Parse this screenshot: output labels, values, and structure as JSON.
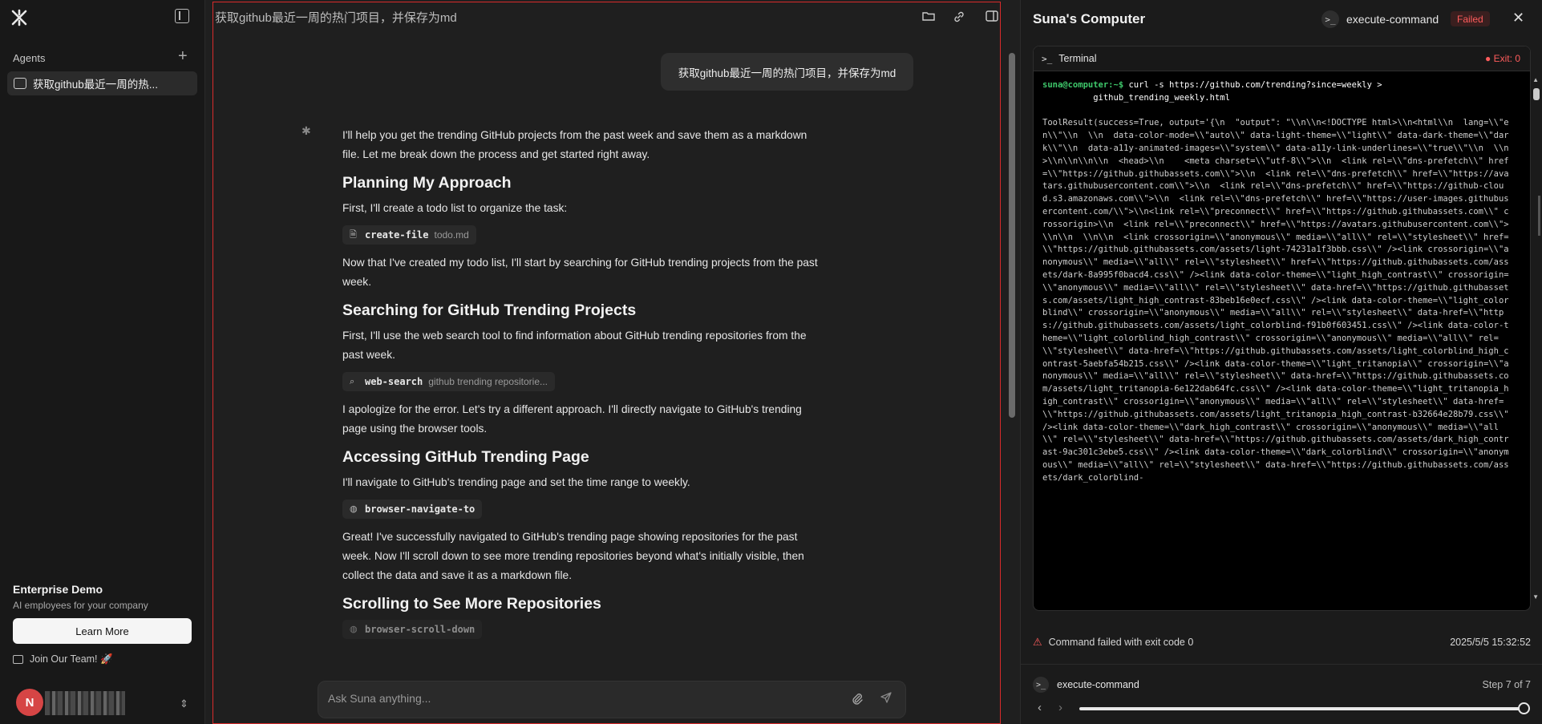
{
  "sidebar": {
    "agents_label": "Agents",
    "agent_items": [
      {
        "label": "获取github最近一周的热..."
      }
    ],
    "enterprise_title": "Enterprise Demo",
    "enterprise_subtitle": "AI employees for your company",
    "learn_more": "Learn More",
    "join_team": "Join Our Team! 🚀",
    "avatar_initial": "N"
  },
  "chat": {
    "title": "获取github最近一周的热门项目，并保存为md",
    "user_message": "获取github最近一周的热门项目，并保存为md",
    "blocks": [
      {
        "type": "p",
        "text": "I'll help you get the trending GitHub projects from the past week and save them as a markdown file. Let me break down the process and get started right away."
      },
      {
        "type": "h",
        "text": "Planning My Approach"
      },
      {
        "type": "p",
        "text": "First, I'll create a todo list to organize the task:"
      },
      {
        "type": "tool",
        "icon": "file-icon",
        "name": "create-file",
        "arg": "todo.md"
      },
      {
        "type": "p",
        "text": "Now that I've created my todo list, I'll start by searching for GitHub trending projects from the past week."
      },
      {
        "type": "h",
        "text": "Searching for GitHub Trending Projects"
      },
      {
        "type": "p",
        "text": "First, I'll use the web search tool to find information about GitHub trending repositories from the past week."
      },
      {
        "type": "tool",
        "icon": "search-icon",
        "name": "web-search",
        "arg": "github trending repositorie..."
      },
      {
        "type": "p",
        "text": "I apologize for the error. Let's try a different approach. I'll directly navigate to GitHub's trending page using the browser tools."
      },
      {
        "type": "h",
        "text": "Accessing GitHub Trending Page"
      },
      {
        "type": "p",
        "text": "I'll navigate to GitHub's trending page and set the time range to weekly."
      },
      {
        "type": "tool",
        "icon": "globe-icon",
        "name": "browser-navigate-to",
        "arg": ""
      },
      {
        "type": "p",
        "text": "Great! I've successfully navigated to GitHub's trending page showing repositories for the past week. Now I'll scroll down to see more trending repositories beyond what's initially visible, then collect the data and save it as a markdown file."
      },
      {
        "type": "h",
        "text": "Scrolling to See More Repositories"
      },
      {
        "type": "tool",
        "icon": "globe-icon",
        "name": "browser-scroll-down",
        "arg": "",
        "fade": true
      }
    ],
    "input_placeholder": "Ask Suna anything..."
  },
  "panel": {
    "title": "Suna's Computer",
    "command": "execute-command",
    "status": "Failed",
    "terminal_label": "Terminal",
    "exit_code": "Exit: 0",
    "prompt_user": "suna@computer:~$",
    "prompt_command": "curl -s https://github.com/trending?since=weekly >\n          github_trending_weekly.html",
    "output": "ToolResult(success=True, output='{\\n  \"output\": \"\\\\n\\\\n<!DOCTYPE html>\\\\n<html\\\\n  lang=\\\\\"en\\\\\"\\\\n  \\\\n  data-color-mode=\\\\\"auto\\\\\" data-light-theme=\\\\\"light\\\\\" data-dark-theme=\\\\\"dark\\\\\"\\\\n  data-a11y-animated-images=\\\\\"system\\\\\" data-a11y-link-underlines=\\\\\"true\\\\\"\\\\n  \\\\n  >\\\\n\\\\n\\\\n\\\\n  <head>\\\\n    <meta charset=\\\\\"utf-8\\\\\">\\\\n  <link rel=\\\\\"dns-prefetch\\\\\" href=\\\\\"https://github.githubassets.com\\\\\">\\\\n  <link rel=\\\\\"dns-prefetch\\\\\" href=\\\\\"https://avatars.githubusercontent.com\\\\\">\\\\n  <link rel=\\\\\"dns-prefetch\\\\\" href=\\\\\"https://github-cloud.s3.amazonaws.com\\\\\">\\\\n  <link rel=\\\\\"dns-prefetch\\\\\" href=\\\\\"https://user-images.githubusercontent.com/\\\\\">\\\\n<link rel=\\\\\"preconnect\\\\\" href=\\\\\"https://github.githubassets.com\\\\\" crossorigin>\\\\n  <link rel=\\\\\"preconnect\\\\\" href=\\\\\"https://avatars.githubusercontent.com\\\\\">\\\\n\\\\n  \\\\n\\\\n  <link crossorigin=\\\\\"anonymous\\\\\" media=\\\\\"all\\\\\" rel=\\\\\"stylesheet\\\\\" href=\\\\\"https://github.githubassets.com/assets/light-74231a1f3bbb.css\\\\\" /><link crossorigin=\\\\\"anonymous\\\\\" media=\\\\\"all\\\\\" rel=\\\\\"stylesheet\\\\\" href=\\\\\"https://github.githubassets.com/assets/dark-8a995f0bacd4.css\\\\\" /><link data-color-theme=\\\\\"light_high_contrast\\\\\" crossorigin=\\\\\"anonymous\\\\\" media=\\\\\"all\\\\\" rel=\\\\\"stylesheet\\\\\" data-href=\\\\\"https://github.githubassets.com/assets/light_high_contrast-83beb16e0ecf.css\\\\\" /><link data-color-theme=\\\\\"light_colorblind\\\\\" crossorigin=\\\\\"anonymous\\\\\" media=\\\\\"all\\\\\" rel=\\\\\"stylesheet\\\\\" data-href=\\\\\"https://github.githubassets.com/assets/light_colorblind-f91b0f603451.css\\\\\" /><link data-color-theme=\\\\\"light_colorblind_high_contrast\\\\\" crossorigin=\\\\\"anonymous\\\\\" media=\\\\\"all\\\\\" rel=\\\\\"stylesheet\\\\\" data-href=\\\\\"https://github.githubassets.com/assets/light_colorblind_high_contrast-5aebfa54b215.css\\\\\" /><link data-color-theme=\\\\\"light_tritanopia\\\\\" crossorigin=\\\\\"anonymous\\\\\" media=\\\\\"all\\\\\" rel=\\\\\"stylesheet\\\\\" data-href=\\\\\"https://github.githubassets.com/assets/light_tritanopia-6e122dab64fc.css\\\\\" /><link data-color-theme=\\\\\"light_tritanopia_high_contrast\\\\\" crossorigin=\\\\\"anonymous\\\\\" media=\\\\\"all\\\\\" rel=\\\\\"stylesheet\\\\\" data-href=\\\\\"https://github.githubassets.com/assets/light_tritanopia_high_contrast-b32664e28b79.css\\\\\" /><link data-color-theme=\\\\\"dark_high_contrast\\\\\" crossorigin=\\\\\"anonymous\\\\\" media=\\\\\"all\\\\\" rel=\\\\\"stylesheet\\\\\" data-href=\\\\\"https://github.githubassets.com/assets/dark_high_contrast-9ac301c3ebe5.css\\\\\" /><link data-color-theme=\\\\\"dark_colorblind\\\\\" crossorigin=\\\\\"anonymous\\\\\" media=\\\\\"all\\\\\" rel=\\\\\"stylesheet\\\\\" data-href=\\\\\"https://github.githubassets.com/assets/dark_colorblind-",
    "fail_message": "Command failed with exit code 0",
    "timestamp": "2025/5/5 15:32:52",
    "step_command": "execute-command",
    "step_label": "Step 7 of 7",
    "step_progress": 1.0
  },
  "colors": {
    "accent_red": "#d92b2b",
    "failed": "#ff5c5c",
    "prompt_green": "#3ec86b"
  }
}
